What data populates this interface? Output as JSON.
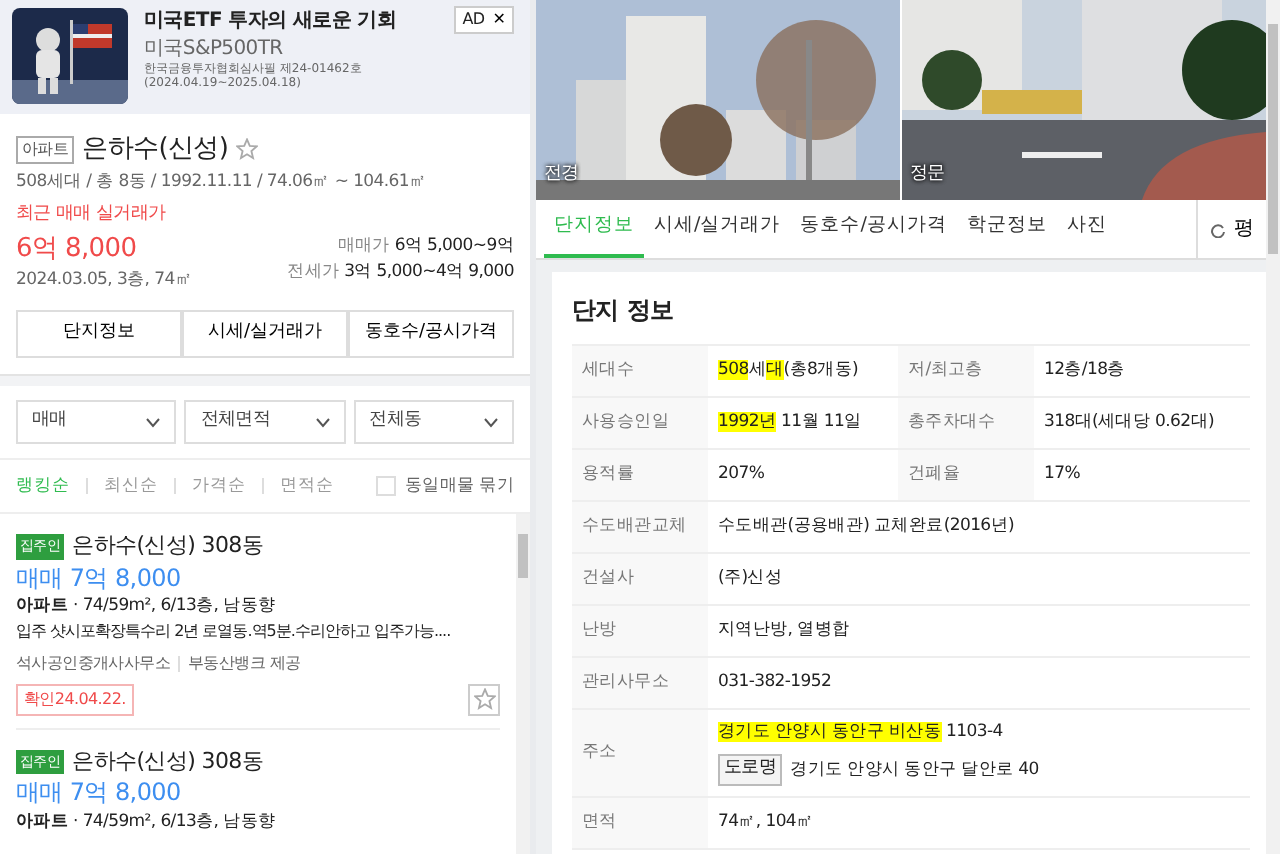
{
  "ad": {
    "badge": "AD",
    "close": "✕",
    "title": "미국ETF 투자의 새로운 기회",
    "subtitle": "미국S&P500TR",
    "disclaimer": "한국금융투자협회심사필 제24-01462호(2024.04.19~2025.04.18)"
  },
  "summary": {
    "type_badge": "아파트",
    "name": "은하수(신성)",
    "favorite": false,
    "meta": "508세대 / 총 8동 / 1992.11.11 / 74.06㎡ ~ 104.61㎡",
    "recent_label": "최근 매매 실거래가",
    "recent_price": "6억 8,000",
    "recent_detail": "2024.03.05, 3층, 74㎡",
    "prices": [
      {
        "label": "매매가",
        "value": "6억 5,000~9억"
      },
      {
        "label": "전세가",
        "value": "3억 5,000~4억 9,000"
      }
    ]
  },
  "quick_buttons": [
    "단지정보",
    "시세/실거래가",
    "동호수/공시가격"
  ],
  "filters": [
    {
      "label": "매매"
    },
    {
      "label": "전체면적"
    },
    {
      "label": "전체동"
    }
  ],
  "sort": [
    {
      "label": "랭킹순",
      "selected": true
    },
    {
      "label": "최신순",
      "selected": false
    },
    {
      "label": "가격순",
      "selected": false
    },
    {
      "label": "면적순",
      "selected": false
    }
  ],
  "group_same": {
    "label": "동일매물 묶기",
    "checked": false
  },
  "listings": [
    {
      "owner_badge": "집주인",
      "title": "은하수(신성) 308동",
      "price": "매매 7억 8,000",
      "spec": "**아파트** · 74/59m², 6/13층, 남동향",
      "desc": "입주 샷시포확장특수리 2년 로열동.역5분.수리안하고 입주가능....",
      "sources": [
        "석사공인중개사사무소",
        "부동산뱅크 제공"
      ],
      "confirmed": "확인24.04.22.",
      "favorite": false
    },
    {
      "owner_badge": "집주인",
      "title": "은하수(신성) 308동",
      "price": "매매 7억 8,000",
      "spec": "**아파트** · 74/59m², 6/13층, 남동향"
    }
  ],
  "photos": [
    {
      "caption": "전경"
    },
    {
      "caption": "정문"
    }
  ],
  "tabs": [
    {
      "label": "단지정보",
      "selected": true
    },
    {
      "label": "시세/실거래가",
      "selected": false
    },
    {
      "label": "동호수/공시가격",
      "selected": false
    },
    {
      "label": "학군정보",
      "selected": false
    },
    {
      "label": "사진",
      "selected": false
    }
  ],
  "unit_toggle": "평",
  "section_title": "단지 정보",
  "rows": [
    {
      "cells": [
        {
          "label": "세대수",
          "lines": [
            [
              {
                "text": "508",
                "highlight": true
              },
              {
                "text": "세",
                "highlight": false
              },
              {
                "text": "대",
                "highlight": true
              },
              {
                "text": "(총8개동)",
                "highlight": false
              }
            ]
          ]
        },
        {
          "label": "저/최고층",
          "lines": [
            [
              {
                "text": "12층/18층",
                "highlight": false
              }
            ]
          ]
        }
      ]
    },
    {
      "cells": [
        {
          "label": "사용승인일",
          "lines": [
            [
              {
                "text": "1992년",
                "highlight": true
              },
              {
                "text": " 11월 11일",
                "highlight": false
              }
            ]
          ]
        },
        {
          "label": "총주차대수",
          "lines": [
            [
              {
                "text": "318대(세대당 0.62대)",
                "highlight": false
              }
            ]
          ]
        }
      ]
    },
    {
      "cells": [
        {
          "label": "용적률",
          "lines": [
            [
              {
                "text": "207%",
                "highlight": false
              }
            ]
          ]
        },
        {
          "label": "건폐율",
          "lines": [
            [
              {
                "text": "17%",
                "highlight": false
              }
            ]
          ]
        }
      ]
    },
    {
      "cells": [
        {
          "label": "수도배관교체",
          "lines": [
            [
              {
                "text": "수도배관(공용배관) 교체완료(2016년)",
                "highlight": false
              }
            ]
          ]
        }
      ]
    },
    {
      "cells": [
        {
          "label": "건설사",
          "lines": [
            [
              {
                "text": "(주)신성",
                "highlight": false
              }
            ]
          ]
        }
      ]
    },
    {
      "cells": [
        {
          "label": "난방",
          "lines": [
            [
              {
                "text": "지역난방, 열병합",
                "highlight": false
              }
            ]
          ]
        }
      ]
    },
    {
      "cells": [
        {
          "label": "관리사무소",
          "lines": [
            [
              {
                "text": "031-382-1952",
                "highlight": false
              }
            ]
          ]
        }
      ]
    },
    {
      "cells": [
        {
          "label": "주소",
          "lines": [
            [
              {
                "text": "경기도 안양시 동안구 비산동",
                "highlight": true
              },
              {
                "text": " 1103-4",
                "highlight": false
              }
            ]
          ],
          "road": {
            "tag": "도로명",
            "text": "경기도 안양시 동안구 달안로 40"
          }
        }
      ]
    },
    {
      "cells": [
        {
          "label": "면적",
          "lines": [
            [
              {
                "text": "74㎡, 104㎡",
                "highlight": false
              }
            ]
          ]
        }
      ]
    }
  ]
}
